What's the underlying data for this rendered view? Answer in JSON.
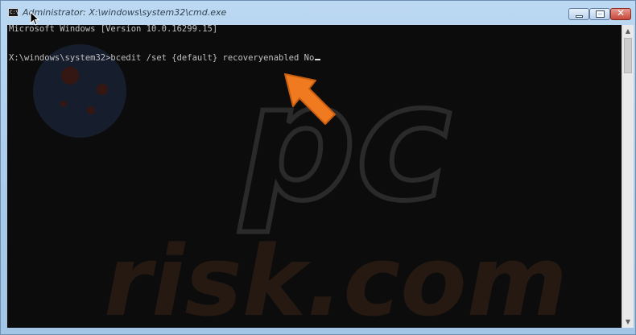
{
  "window": {
    "title": "Administrator: X:\\windows\\system32\\cmd.exe",
    "icon_label": "C:\\"
  },
  "console": {
    "line1": "Microsoft Windows [Version 10.0.16299.15]",
    "line2": "X:\\windows\\system32>bcedit /set {default} recoveryenabled No"
  },
  "watermark": {
    "text": "risk.com",
    "logo": "pc"
  },
  "colors": {
    "console_bg": "#0c0c0c",
    "console_text": "#c0c0c0",
    "arrow": "#f07a1f",
    "title_bg": "#aed0ee",
    "close_button": "#c5473a"
  },
  "icons": {
    "app": "cmd-icon",
    "minimize": "minimize-icon",
    "maximize": "maximize-icon",
    "close": "close-icon",
    "pointer": "arrow-pointer-icon",
    "mouse": "mouse-cursor-icon"
  }
}
